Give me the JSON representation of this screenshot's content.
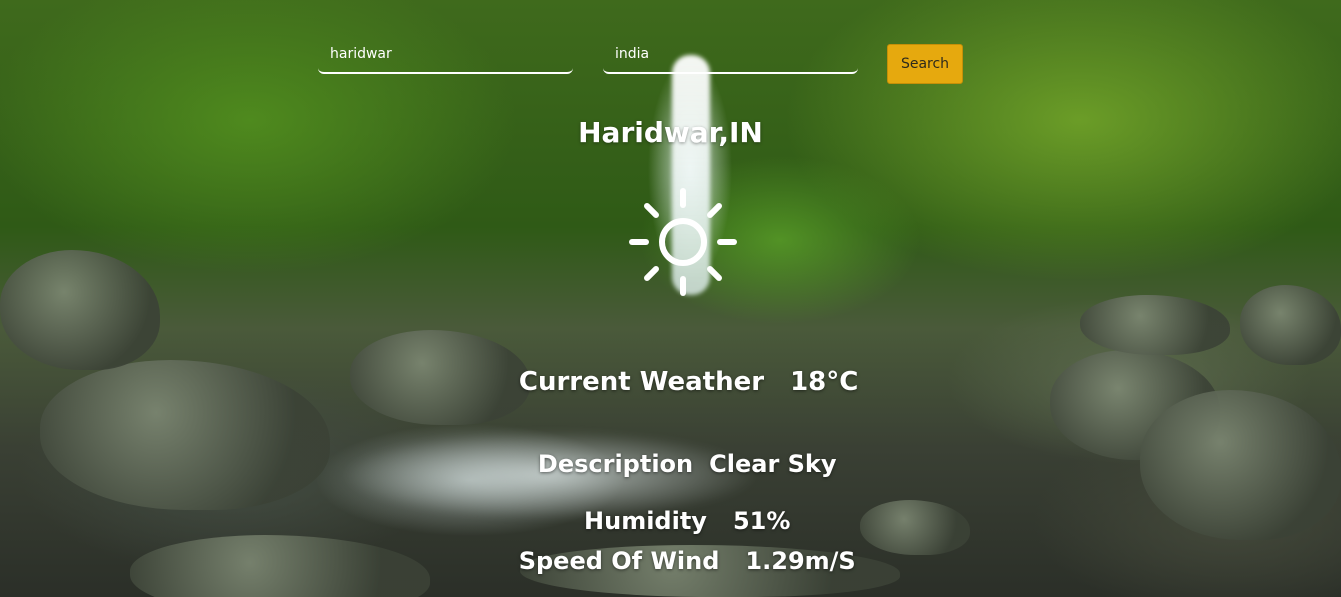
{
  "search": {
    "city_value": "haridwar",
    "country_value": "india",
    "button_label": "Search"
  },
  "location": {
    "title": "Haridwar,IN"
  },
  "icon": {
    "name": "sun-icon"
  },
  "weather": {
    "current_label": "Current Weather",
    "current_value": "18°C",
    "description_label": "Description",
    "description_value": "Clear Sky",
    "humidity_label": "Humidity",
    "humidity_value": "51%",
    "wind_label": "Speed Of Wind",
    "wind_value": "1.29m/S"
  },
  "colors": {
    "accent": "#e6a90e",
    "text": "#ffffff"
  }
}
